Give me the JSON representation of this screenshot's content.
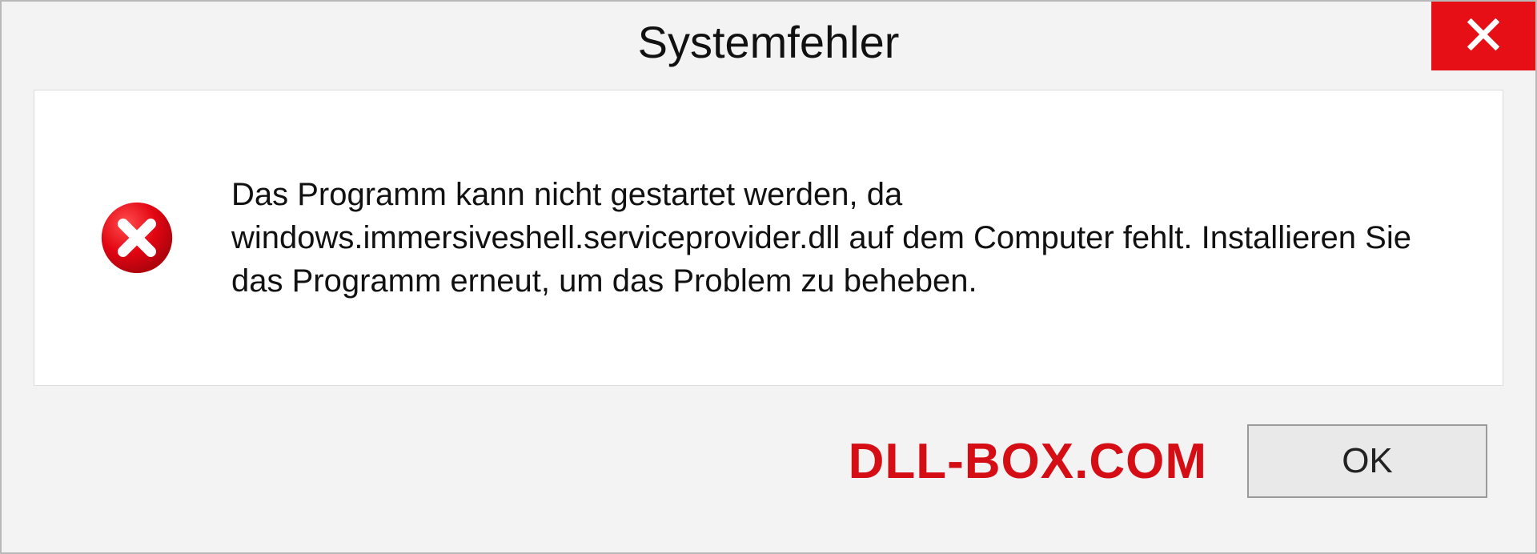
{
  "dialog": {
    "title": "Systemfehler",
    "message": "Das Programm kann nicht gestartet werden, da windows.immersiveshell.serviceprovider.dll auf dem Computer fehlt. Installieren Sie das Programm erneut, um das Problem zu beheben.",
    "ok_label": "OK",
    "watermark": "DLL-BOX.COM",
    "colors": {
      "close_button_bg": "#e60f16",
      "error_icon_fill": "#e20512",
      "watermark_color": "#d40e14"
    }
  }
}
